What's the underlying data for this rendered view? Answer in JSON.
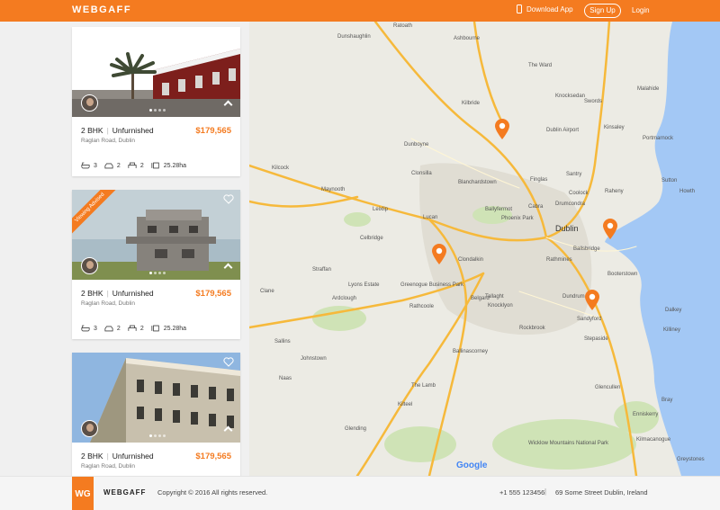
{
  "header": {
    "brand": "WEBGAFF",
    "download_label": "Download App",
    "signup_label": "Sign Up",
    "login_label": "Login"
  },
  "listings": [
    {
      "type": "2 BHK",
      "furnishing": "Unfurnished",
      "price": "$179,565",
      "address": "Raglan Road, Dublin",
      "baths": "3",
      "parking": "2",
      "beds": "2",
      "area": "25.28ha",
      "ribbon": ""
    },
    {
      "type": "2 BHK",
      "furnishing": "Unfurnished",
      "price": "$179,565",
      "address": "Raglan Road, Dublin",
      "baths": "3",
      "parking": "2",
      "beds": "2",
      "area": "25.28ha",
      "ribbon": "Viewing Advised"
    },
    {
      "type": "2 BHK",
      "furnishing": "Unfurnished",
      "price": "$179,565",
      "address": "Raglan Road, Dublin",
      "baths": "",
      "parking": "",
      "beds": "",
      "area": "",
      "ribbon": ""
    }
  ],
  "map": {
    "labels": [
      "Dunshaughlin",
      "Ratoath",
      "Ashbourne",
      "Swords",
      "Malahide",
      "Portmarnock",
      "Blanchardstown",
      "Finglas",
      "Santry",
      "Coolock",
      "Raheny",
      "Howth",
      "Sutton",
      "Dublin Airport",
      "Dublin",
      "Ballsbridge",
      "Rathmines",
      "Lucan",
      "Clondalkin",
      "Leixlip",
      "Maynooth",
      "Celbridge",
      "Straffan",
      "Clane",
      "Naas",
      "Kilcock",
      "Dunboyne",
      "Rathcoole",
      "Tallaght",
      "Dundrum",
      "Sandyford",
      "Stepaside",
      "Knocklyon",
      "Booterstown",
      "Dalkey",
      "Killiney",
      "Bray",
      "Greystones",
      "Enniskerry",
      "Glencullen",
      "Johnstown",
      "Sallins",
      "Kilteel",
      "Ardclough",
      "Lyons Estate",
      "Greenogue Business Park",
      "Ballinascorney",
      "Glending",
      "Kilmacanogue",
      "Wicklow Mountains National Park",
      "Cabra",
      "Drumcondra",
      "Phoenix Park",
      "Ballyfermot",
      "Clonsilla",
      "Kilbride",
      "The Ward",
      "Knocksedan",
      "Kinsaley",
      "Belgard",
      "Rockbrook",
      "The Lamb"
    ],
    "google": "Google"
  },
  "footer": {
    "logo": "WG",
    "brand": "WEBGAFF",
    "copyright": "Copyright © 2016 All rights reserved.",
    "phone": "+1 555 123456",
    "separator": "|",
    "address": "69 Some Street Dublin, Ireland"
  },
  "colors": {
    "accent": "#f47b20",
    "sea": "#a3c8f5",
    "road": "#f6b93b"
  }
}
